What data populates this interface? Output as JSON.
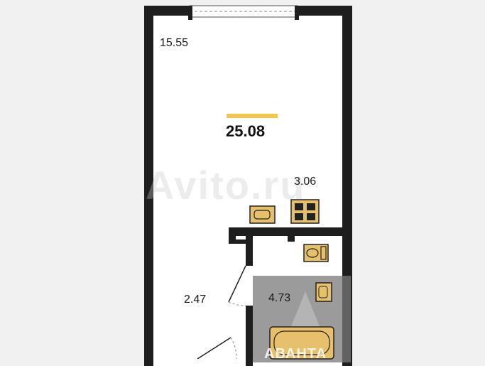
{
  "rooms": {
    "main_room_area": "15.55",
    "total_area": "25.08",
    "kitchen_area": "3.06",
    "hall_area": "2.47",
    "bathroom_area": "4.73"
  },
  "watermark_text": "Avito.ru",
  "brand_text": "АВАНТА",
  "colors": {
    "wall": "#1e1e1e",
    "floor": "#ffffff",
    "background": "#f1f1f1",
    "accent": "#f4c64a",
    "fixture": "#e6c06a",
    "overlay": "#7a7a7a"
  }
}
